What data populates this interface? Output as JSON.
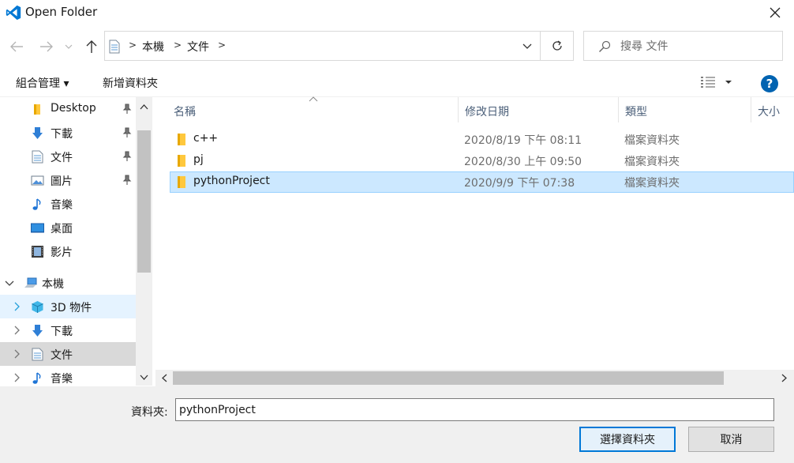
{
  "window": {
    "title": "Open Folder"
  },
  "address": {
    "crumbs": [
      "本機",
      "文件"
    ],
    "search_placeholder": "搜尋 文件"
  },
  "toolbar": {
    "organize_label": "組合管理 ▾",
    "new_folder_label": "新增資料夾"
  },
  "nav": {
    "quick_access": [
      {
        "label": "Desktop",
        "icon": "folder-icon",
        "pinned": true
      },
      {
        "label": "下載",
        "icon": "download-icon",
        "pinned": true
      },
      {
        "label": "文件",
        "icon": "document-icon",
        "pinned": true
      },
      {
        "label": "圖片",
        "icon": "picture-icon",
        "pinned": true
      },
      {
        "label": "音樂",
        "icon": "music-icon",
        "pinned": false
      },
      {
        "label": "桌面",
        "icon": "desktop-icon",
        "pinned": false
      },
      {
        "label": "影片",
        "icon": "video-icon",
        "pinned": false
      }
    ],
    "this_pc": "本機",
    "this_pc_children": [
      {
        "label": "3D 物件",
        "icon": "cube-3d-icon"
      },
      {
        "label": "下載",
        "icon": "download-icon"
      },
      {
        "label": "文件",
        "icon": "document-icon"
      },
      {
        "label": "音樂",
        "icon": "music-icon"
      }
    ]
  },
  "columns": {
    "name": "名稱",
    "modified": "修改日期",
    "type": "類型",
    "size": "大小"
  },
  "files": [
    {
      "name": "c++",
      "modified": "2020/8/19 下午 08:11",
      "type": "檔案資料夾",
      "selected": false
    },
    {
      "name": "pj",
      "modified": "2020/8/30 上午 09:50",
      "type": "檔案資料夾",
      "selected": false
    },
    {
      "name": "pythonProject",
      "modified": "2020/9/9 下午 07:38",
      "type": "檔案資料夾",
      "selected": true
    }
  ],
  "footer": {
    "folder_label": "資料夾:",
    "folder_value": "pythonProject",
    "select_button": "選擇資料夾",
    "cancel_button": "取消"
  },
  "colors": {
    "accent": "#0078d7",
    "selection": "#cce8ff",
    "help": "#0063b1",
    "folder": "#ffc83d"
  }
}
